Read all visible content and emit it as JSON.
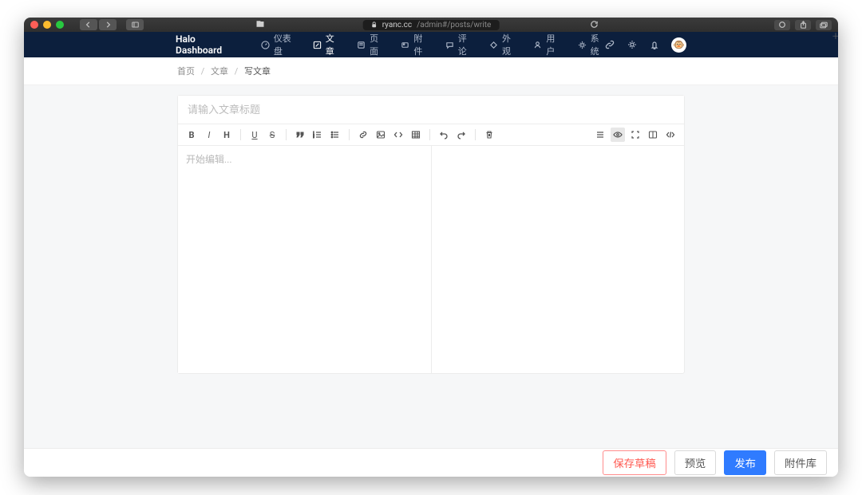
{
  "browser": {
    "url_host": "ryanc.cc",
    "url_path": "/admin#/posts/write"
  },
  "brand": "Halo Dashboard",
  "nav": {
    "items": [
      {
        "label": "仪表盘",
        "icon": "gauge"
      },
      {
        "label": "文章",
        "icon": "edit",
        "active": true
      },
      {
        "label": "页面",
        "icon": "page"
      },
      {
        "label": "附件",
        "icon": "attachment"
      },
      {
        "label": "评论",
        "icon": "comment"
      },
      {
        "label": "外观",
        "icon": "palette"
      },
      {
        "label": "用户",
        "icon": "user"
      },
      {
        "label": "系统",
        "icon": "gear"
      }
    ]
  },
  "breadcrumb": {
    "items": [
      "首页",
      "文章",
      "写文章"
    ]
  },
  "editor": {
    "title_placeholder": "请输入文章标题",
    "content_placeholder": "开始编辑..."
  },
  "footer": {
    "save_draft": "保存草稿",
    "preview": "预览",
    "publish": "发布",
    "attachments": "附件库"
  }
}
